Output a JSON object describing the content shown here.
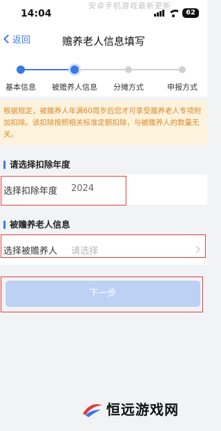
{
  "status_bar": {
    "time": "14:04",
    "battery": "62"
  },
  "top_watermark": "安卓手机游戏最新更新",
  "nav": {
    "back_label": "返回",
    "title": "赡养老人信息填写"
  },
  "steps": {
    "items": [
      {
        "label": "基本信息",
        "state": "done"
      },
      {
        "label": "被赡养人信息",
        "state": "current"
      },
      {
        "label": "分摊方式",
        "state": "pending"
      },
      {
        "label": "申报方式",
        "state": "pending"
      }
    ],
    "colors": {
      "active": "#3a78e8",
      "inactive": "#cfcfd4"
    }
  },
  "notice": "根据规定，被赡养人年满60周岁后您才可享受赡养老人专项附加扣除。该扣除按照相关标准定额扣除，与被赡养人的数量无关。",
  "sections": {
    "year": {
      "title": "请选择扣除年度",
      "label": "选择扣除年度",
      "value": "2024"
    },
    "supported": {
      "title": "被赡养老人信息",
      "label": "选择被赡养人",
      "placeholder": "请选择"
    }
  },
  "next_button": "下一步",
  "logo_text": "恒远游戏网"
}
